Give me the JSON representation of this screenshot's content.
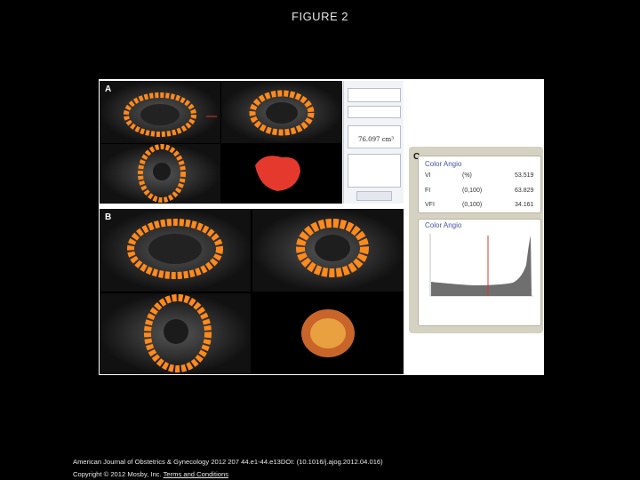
{
  "figure_title": "FIGURE 2",
  "panels": {
    "a_label": "A",
    "b_label": "B",
    "c_label": "C"
  },
  "volume": {
    "value": "76.097 cm³"
  },
  "color_angio": {
    "title": "Color Angio",
    "rows": [
      {
        "name": "VI",
        "range": "(%)",
        "value": "53.519"
      },
      {
        "name": "FI",
        "range": "(0,100)",
        "value": "63.829"
      },
      {
        "name": "VFI",
        "range": "(0,100)",
        "value": "34.161"
      }
    ],
    "histogram_title": "Color Angio"
  },
  "footer": {
    "citation": "American Journal of Obstetrics & Gynecology 2012 207 44.e1-44.e13DOI: (10.1016/j.ajog.2012.04.016)",
    "copyright": "Copyright © 2012 Mosby, Inc.",
    "link": "Terms and Conditions"
  },
  "colors": {
    "background": "#000000",
    "doppler_orange": "#ff8a1a",
    "cutline_red": "#d63a2b",
    "label_blue": "#4a52a8"
  }
}
